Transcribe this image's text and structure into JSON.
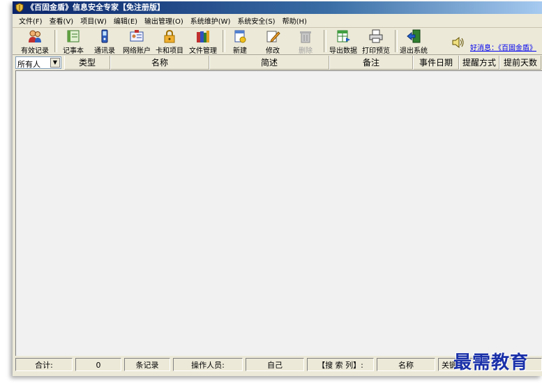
{
  "window": {
    "title": "《百固金盾》信息安全专家【免注册版】"
  },
  "menu": [
    "文件(F)",
    "查看(V)",
    "项目(W)",
    "编辑(E)",
    "输出管理(O)",
    "系统维护(W)",
    "系统安全(S)",
    "帮助(H)"
  ],
  "toolbar": {
    "valid_records": "有效记录",
    "notebook": "记事本",
    "contacts": "通讯录",
    "net_accounts": "网络账户",
    "cards": "卡和项目",
    "files": "文件管理",
    "new": "新建",
    "modify": "修改",
    "delete": "删除",
    "export": "导出数据",
    "print_preview": "打印预览",
    "exit": "退出系统",
    "message_link": "好消息：《百固金盾》"
  },
  "header": {
    "owner_selected": "所有人",
    "columns": [
      "类型",
      "名称",
      "简述",
      "备注",
      "事件日期",
      "提醒方式",
      "提前天数"
    ]
  },
  "status": {
    "total_label": "合计:",
    "count": "0",
    "count_unit": "条记录",
    "operator_label": "操作人员:",
    "operator_value": "自己",
    "search_col_label": "【搜 索 列】:",
    "search_col_value": "名称",
    "keyword_label": "关键"
  },
  "watermark": "最需教育"
}
